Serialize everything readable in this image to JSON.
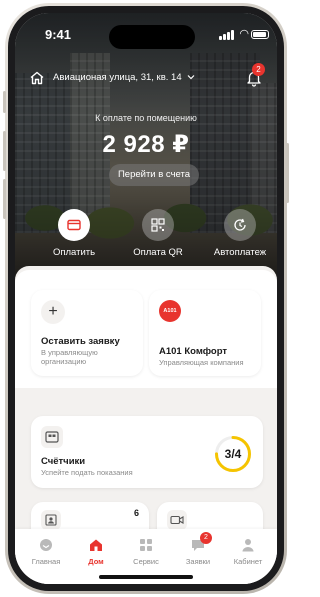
{
  "status_bar": {
    "time": "9:41"
  },
  "header": {
    "address": "Авиационая улица, 31, кв. 14",
    "notifications_badge": "2"
  },
  "balance": {
    "label": "К оплате по помещению",
    "amount": "2 928 ₽",
    "bills_button": "Перейти в счета"
  },
  "quick_actions": [
    {
      "label": "Оплатить",
      "icon": "card-icon"
    },
    {
      "label": "Оплата QR",
      "icon": "qr-icon"
    },
    {
      "label": "Автоплатеж",
      "icon": "autopay-icon"
    }
  ],
  "cards": {
    "request": {
      "title": "Оставить заявку",
      "subtitle": "В управляющую организацию"
    },
    "company": {
      "logo_text": "A101",
      "title": "A101 Комфорт",
      "subtitle": "Управляющая компания"
    },
    "meters": {
      "title": "Счётчики",
      "subtitle": "Успейте подать показания",
      "progress": "3/4",
      "progress_fraction": 0.75
    },
    "pass": {
      "count": "6"
    },
    "video": {}
  },
  "tabbar": {
    "items": [
      {
        "label": "Главная",
        "icon": "home-icon"
      },
      {
        "label": "Дом",
        "icon": "house-icon",
        "active": true
      },
      {
        "label": "Сервис",
        "icon": "grid-icon"
      },
      {
        "label": "Заявки",
        "icon": "chat-icon",
        "badge": "2"
      },
      {
        "label": "Кабинет",
        "icon": "user-icon"
      }
    ]
  },
  "colors": {
    "accent": "#e8342e",
    "progress_ring": "#f5c400"
  }
}
